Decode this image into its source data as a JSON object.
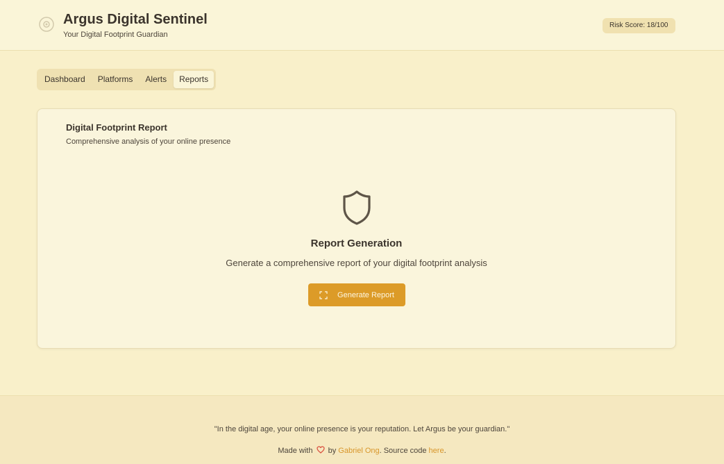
{
  "header": {
    "title": "Argus Digital Sentinel",
    "subtitle": "Your Digital Footprint Guardian",
    "risk_badge": "Risk Score: 18/100",
    "logo_icon": "sentinel-logo-icon"
  },
  "tabs": [
    {
      "label": "Dashboard",
      "active": false
    },
    {
      "label": "Platforms",
      "active": false
    },
    {
      "label": "Alerts",
      "active": false
    },
    {
      "label": "Reports",
      "active": true
    }
  ],
  "report_card": {
    "title": "Digital Footprint Report",
    "description": "Comprehensive analysis of your online presence",
    "icon": "shield-icon",
    "section_title": "Report Generation",
    "section_description": "Generate a comprehensive report of your digital footprint analysis",
    "button_label": "Generate Report",
    "button_icon": "scan-icon"
  },
  "footer": {
    "quote": "\"In the digital age, your online presence is your reputation. Let Argus be your guardian.\"",
    "made_with": "Made with",
    "by": "by",
    "author": "Gabriel Ong",
    "source_prefix": ". Source code",
    "source_link": "here",
    "suffix": "."
  },
  "colors": {
    "background": "#f9f0ca",
    "accent": "#dc9b28",
    "heart": "#d94a3a",
    "text": "#3b342c"
  }
}
